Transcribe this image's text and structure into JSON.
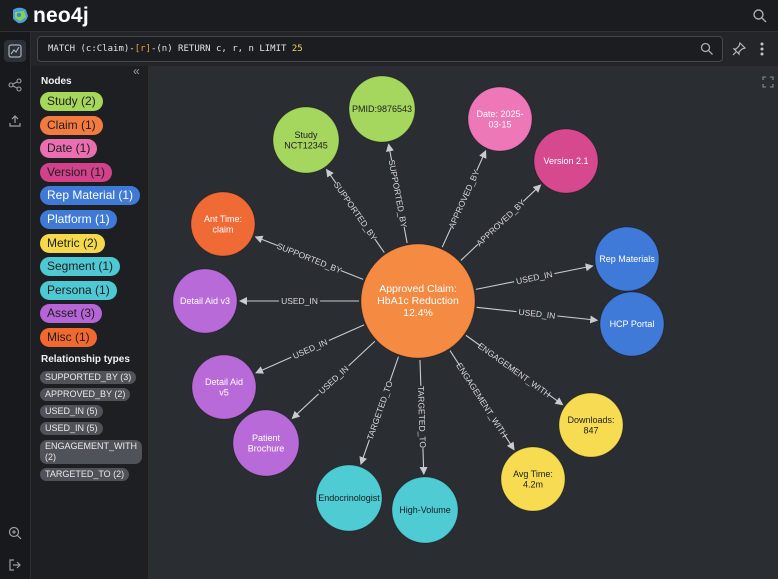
{
  "app": {
    "name": "neo4j"
  },
  "query": {
    "prefix": "MATCH (c:Claim)-",
    "rel": "[r]",
    "middle": "-(n) RETURN c, r, n LIMIT ",
    "limit": "25"
  },
  "sidebar": {
    "nodes_title": "Nodes",
    "rel_title": "Relationship types",
    "node_labels": [
      {
        "label": "Study (2)",
        "color": "#a6d65a",
        "text": "#1d1d1d"
      },
      {
        "label": "Claim (1)",
        "color": "#f47b3f",
        "text": "#1d1d1d"
      },
      {
        "label": "Date (1)",
        "color": "#eb6fb0",
        "text": "#1d1d1d"
      },
      {
        "label": "Version (1)",
        "color": "#d2428a",
        "text": "#1d1d1d"
      },
      {
        "label": "Rep Material (1)",
        "color": "#3e7ad6",
        "text": "#ffffff"
      },
      {
        "label": "Platform (1)",
        "color": "#3e7ad6",
        "text": "#ffffff"
      },
      {
        "label": "Metric (2)",
        "color": "#f5d94c",
        "text": "#1d1d1d"
      },
      {
        "label": "Segment (1)",
        "color": "#4ec9d3",
        "text": "#1d1d1d"
      },
      {
        "label": "Persona (1)",
        "color": "#4ec9d3",
        "text": "#1d1d1d"
      },
      {
        "label": "Asset (3)",
        "color": "#b565d6",
        "text": "#1d1d1d"
      },
      {
        "label": "Misc (1)",
        "color": "#f1692f",
        "text": "#1d1d1d"
      }
    ],
    "relationship_types": [
      {
        "line1": "SUPPORTED_BY (3)",
        "line2": ""
      },
      {
        "line1": "APPROVED_BY (2)",
        "line2": ""
      },
      {
        "line1": "USED_IN (5)",
        "line2": ""
      },
      {
        "line1": "USED_IN (5)",
        "line2": ""
      },
      {
        "line1": "ENGAGEMENT_WITH",
        "line2": "(2)"
      },
      {
        "line1": "TARGETED_TO (2)",
        "line2": ""
      }
    ]
  },
  "graph": {
    "center": {
      "lines": [
        "Approved Claim:",
        "HbA1c Reduction",
        "12.4%"
      ],
      "color": "#f58b42",
      "text": "#ffffff"
    },
    "nodes": [
      {
        "id": "study-nct",
        "lines": [
          "Study",
          "NCT12345"
        ],
        "color": "#a5d65e",
        "text": "#1d1d1d"
      },
      {
        "id": "pmid",
        "lines": [
          "PMID:9876543"
        ],
        "color": "#a5d65e",
        "text": "#1d1d1d"
      },
      {
        "id": "date",
        "lines": [
          "Date: 2025-",
          "03-15"
        ],
        "color": "#ee77b8",
        "text": "#ffffff"
      },
      {
        "id": "version",
        "lines": [
          "Version 2.1"
        ],
        "color": "#d6498f",
        "text": "#ffffff"
      },
      {
        "id": "ant-time",
        "lines": [
          "Ant Time:",
          "claim"
        ],
        "color": "#ef6a35",
        "text": "#ffffff"
      },
      {
        "id": "rep-materials",
        "lines": [
          "Rep Materials"
        ],
        "color": "#3f7ad8",
        "text": "#ffffff"
      },
      {
        "id": "hcp-portal",
        "lines": [
          "HCP Portal"
        ],
        "color": "#3f7ad8",
        "text": "#ffffff"
      },
      {
        "id": "detail-aid-v3",
        "lines": [
          "Detail Aid v3"
        ],
        "color": "#b86bd8",
        "text": "#ffffff"
      },
      {
        "id": "detail-aid-v5",
        "lines": [
          "Detail Aid",
          "v5"
        ],
        "color": "#b86bd8",
        "text": "#ffffff"
      },
      {
        "id": "patient-brochure",
        "lines": [
          "Patient",
          "Brochure"
        ],
        "color": "#b86bd8",
        "text": "#ffffff"
      },
      {
        "id": "endocrinologist",
        "lines": [
          "Endocrinologist"
        ],
        "color": "#4fcbd4",
        "text": "#1d1d1d"
      },
      {
        "id": "high-volume",
        "lines": [
          "High-Volume"
        ],
        "color": "#4fcbd4",
        "text": "#1d1d1d"
      },
      {
        "id": "downloads",
        "lines": [
          "Downloads:",
          "847"
        ],
        "color": "#f7dc52",
        "text": "#1d1d1d"
      },
      {
        "id": "avg-time",
        "lines": [
          "Avg Time:",
          "4.2m"
        ],
        "color": "#f7dc52",
        "text": "#1d1d1d"
      }
    ],
    "edges": [
      {
        "target": "study-nct",
        "label": "SUPPORTED_BY"
      },
      {
        "target": "pmid",
        "label": "SUPPORTED_BY"
      },
      {
        "target": "date",
        "label": "APPROVED_BY"
      },
      {
        "target": "version",
        "label": "APPROVED_BY"
      },
      {
        "target": "ant-time",
        "label": "SUPPORTED_BY"
      },
      {
        "target": "rep-materials",
        "label": "USED_IN"
      },
      {
        "target": "hcp-portal",
        "label": "USED_IN"
      },
      {
        "target": "detail-aid-v3",
        "label": "USED_IN"
      },
      {
        "target": "detail-aid-v5",
        "label": "USED_IN"
      },
      {
        "target": "patient-brochure",
        "label": "USED_IN"
      },
      {
        "target": "endocrinologist",
        "label": "TARGETED_TO"
      },
      {
        "target": "high-volume",
        "label": "TARGETED_TO"
      },
      {
        "target": "downloads",
        "label": "ENGAGEMENT_WITH"
      },
      {
        "target": "avg-time",
        "label": "ENGAGEMENT_WITH"
      }
    ]
  },
  "icons": {
    "logo": "neo4j-logo-icon",
    "search": "search-icon",
    "query": "query-icon",
    "share": "share-icon",
    "upload": "upload-icon",
    "zoom": "zoom-icon",
    "logout": "logout-icon",
    "pin": "pin-icon",
    "more": "more-vertical-icon",
    "expand": "expand-icon",
    "collapse": "collapse-icon"
  }
}
